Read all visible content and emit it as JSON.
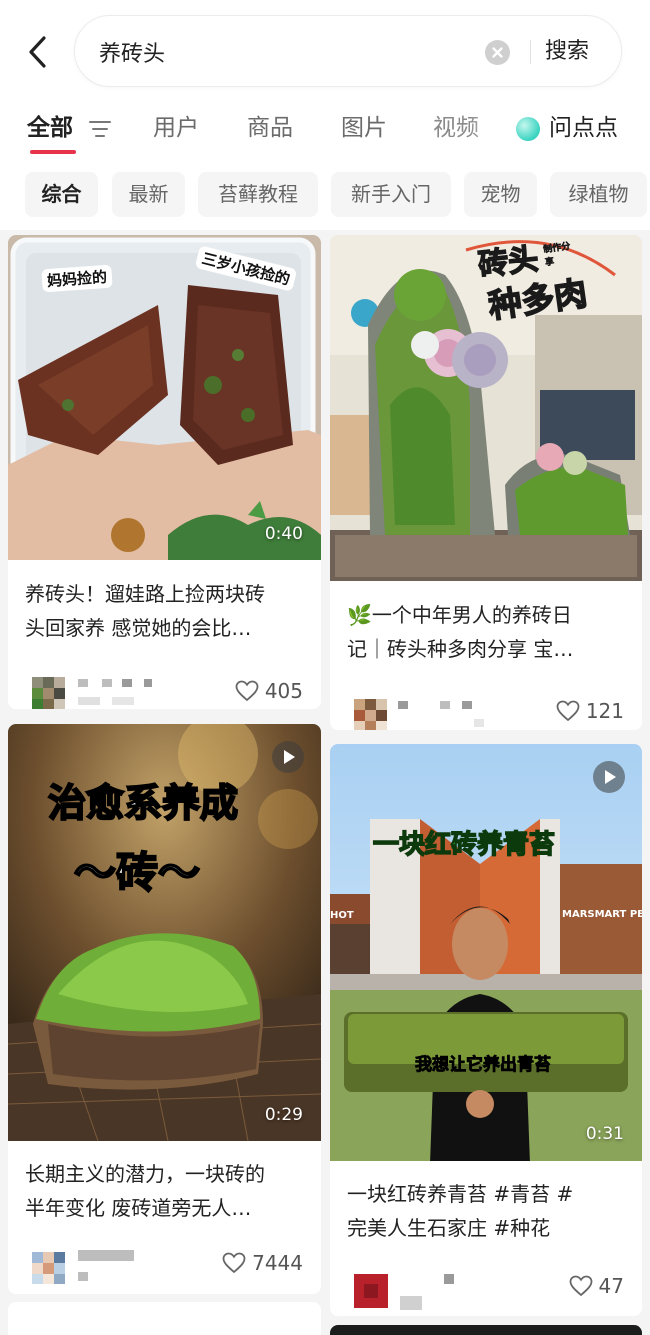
{
  "search": {
    "query": "养砖头",
    "button_label": "搜索"
  },
  "tabs": [
    {
      "label": "全部"
    },
    {
      "label": "用户"
    },
    {
      "label": "商品"
    },
    {
      "label": "图片"
    },
    {
      "label": "视频"
    }
  ],
  "wendian_label": "问点点",
  "chips": [
    {
      "label": "综合"
    },
    {
      "label": "最新"
    },
    {
      "label": "苔藓教程"
    },
    {
      "label": "新手入门"
    },
    {
      "label": "宠物"
    },
    {
      "label": "绿植物"
    }
  ],
  "posts": [
    {
      "title_line1": "养砖头！遛娃路上捡两块砖",
      "title_line2": "头回家养 感觉她的会比…",
      "likes": "405",
      "duration": "0:40",
      "image_labels": [
        "妈妈捡的",
        "三岁小孩捡的"
      ]
    },
    {
      "title_line1": "🌿一个中年男人的养砖日",
      "title_line2": "记｜砖头种多肉分享 宝…",
      "likes": "121",
      "image_labels": [
        "砖头",
        "种多肉",
        "制作分享"
      ]
    },
    {
      "title_line1": "长期主义的潜力，一块砖的",
      "title_line2": "半年变化 废砖道旁无人…",
      "likes": "7444",
      "duration": "0:29",
      "image_labels": [
        "治愈系养成",
        "～砖～"
      ]
    },
    {
      "title_line1": "一块红砖养青苔 #青苔 #",
      "title_line2": "完美人生石家庄 #种花",
      "likes": "47",
      "duration": "0:31",
      "image_labels": [
        "一块红砖养青苔",
        "我想让它养出青苔",
        "MARSMART PETS",
        "HOT"
      ]
    }
  ],
  "colors": {
    "accent": "#e8344a",
    "chip_bg": "#f5f5f5",
    "feed_bg": "#f4f4f4",
    "overlay_green": "#4be04b"
  }
}
